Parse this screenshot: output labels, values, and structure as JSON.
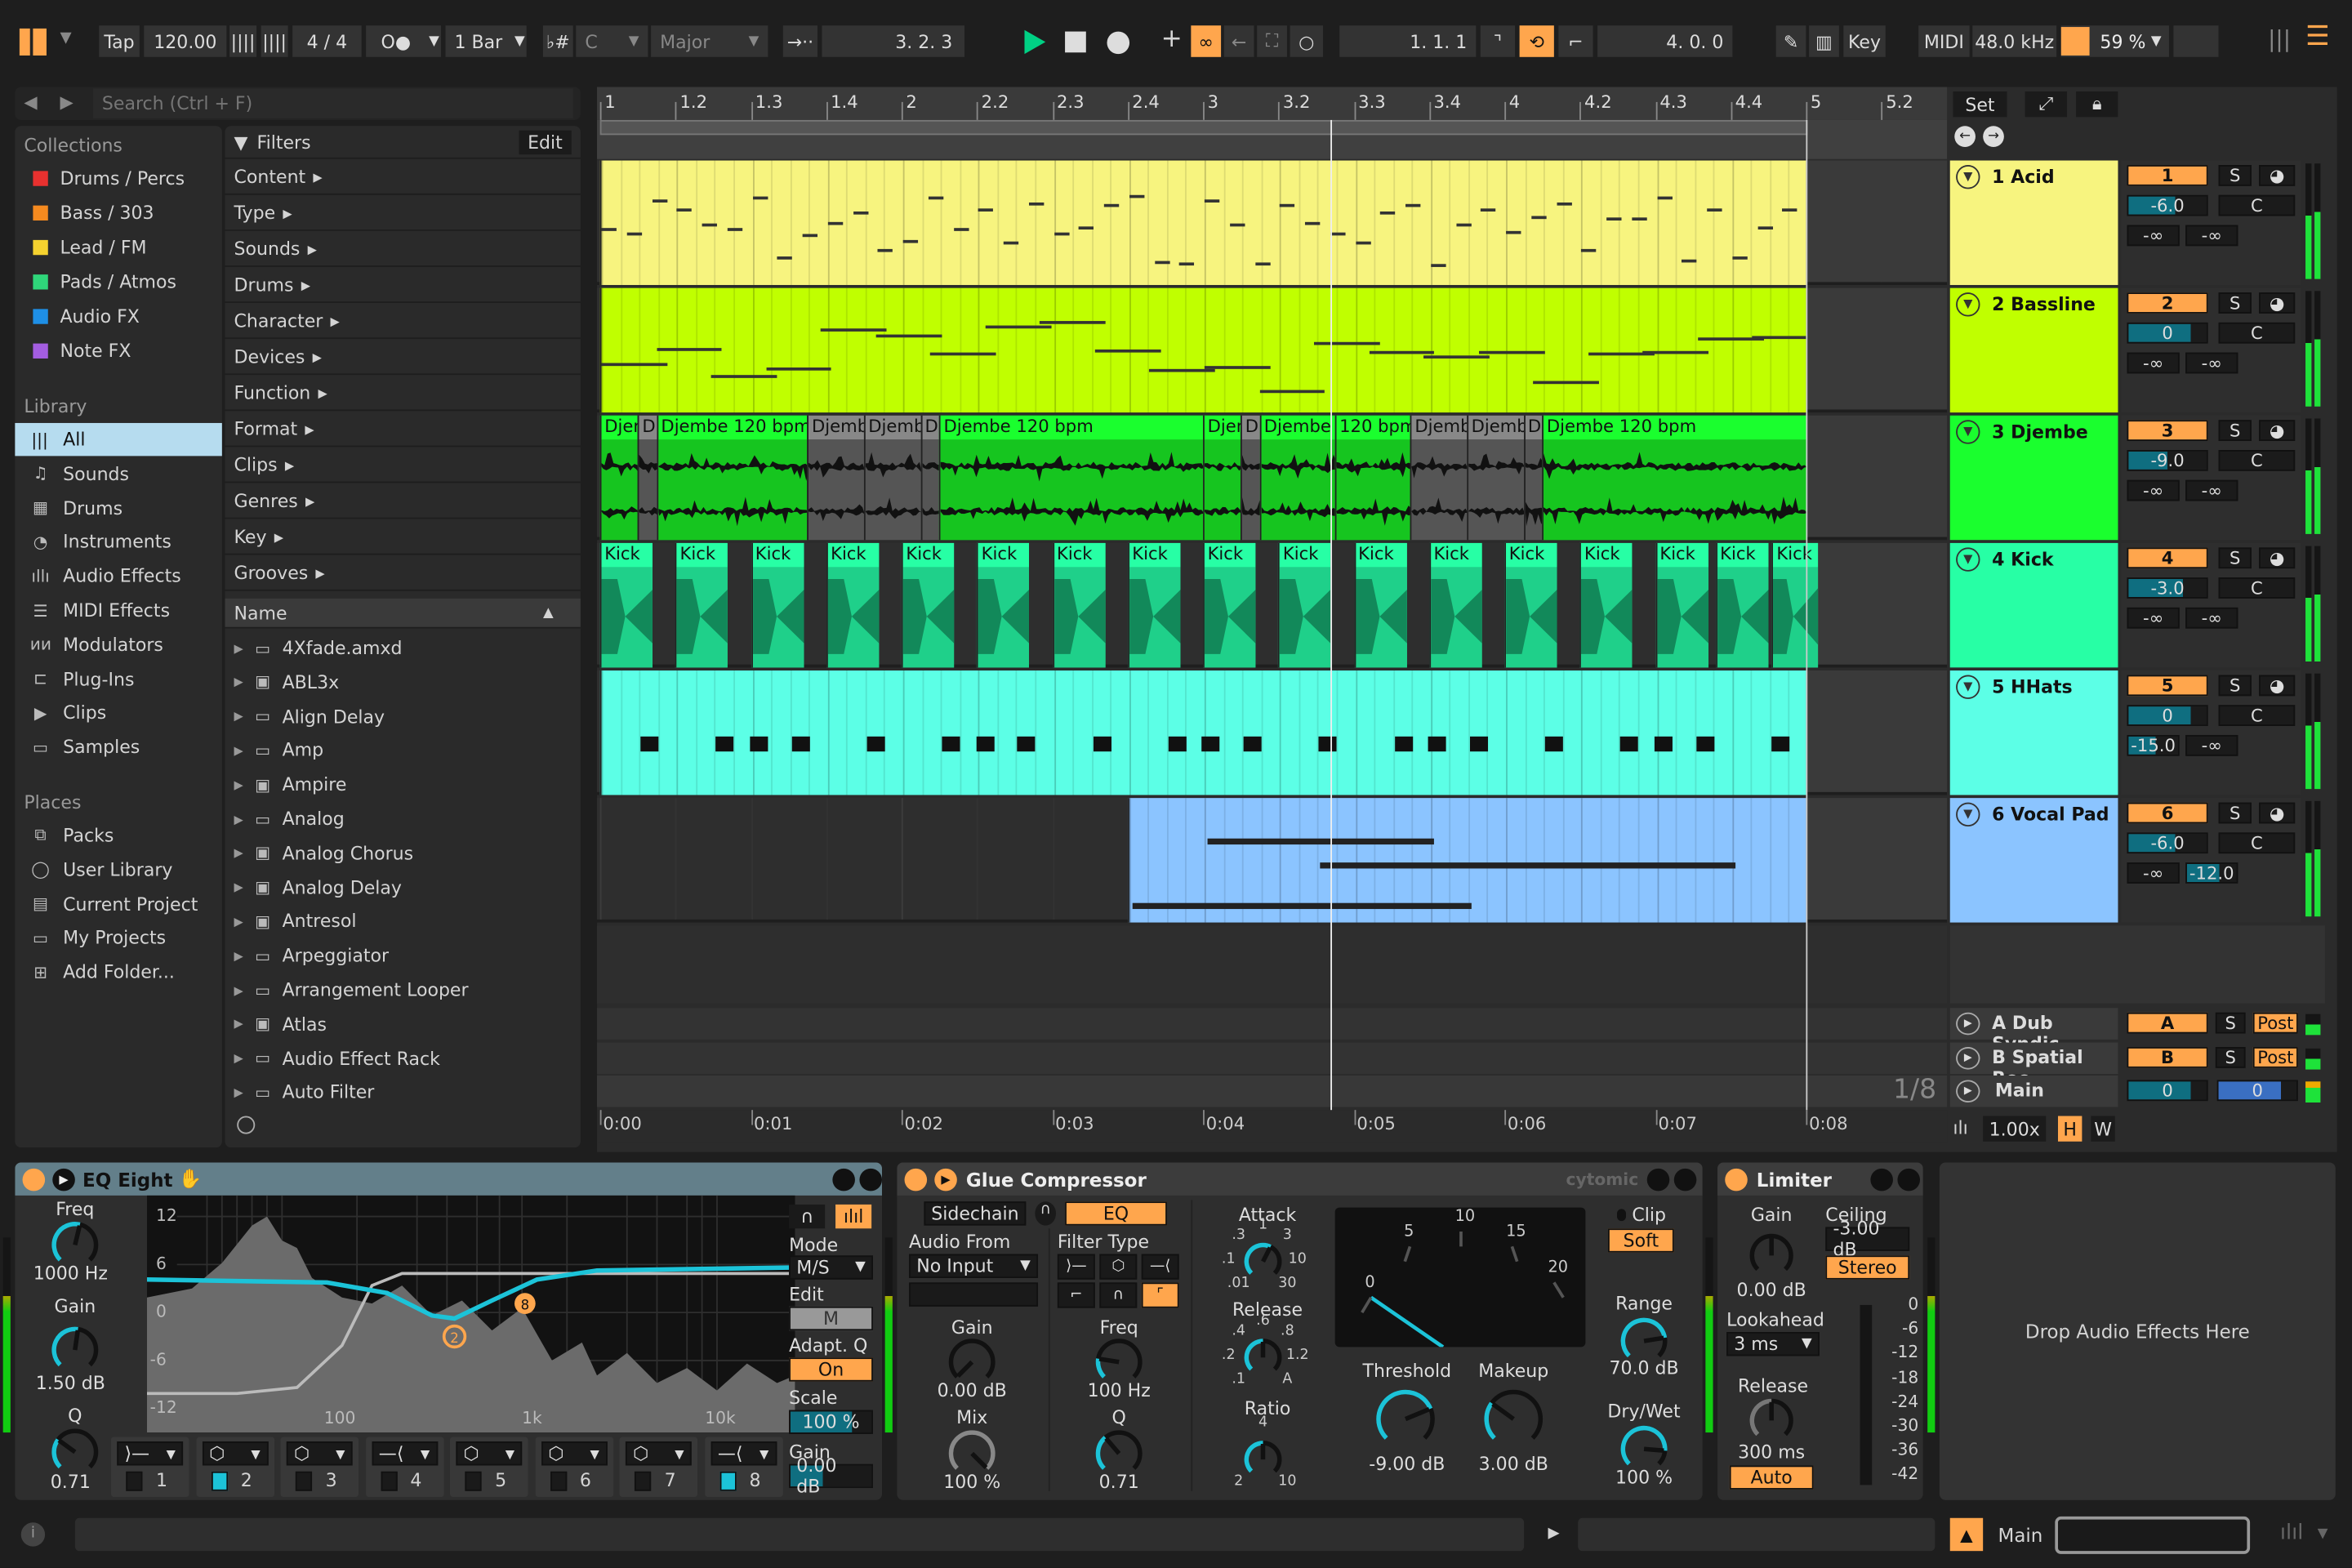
{
  "toolbar": {
    "tap": "Tap",
    "tempo": "120.00",
    "time_sig": "4 / 4",
    "metro": "O●",
    "quant": "1 Bar",
    "key_icon": "♭#",
    "key": "C",
    "scale": "Major",
    "position": "3.  2.  3",
    "loop_start": "1.  1.  1",
    "loop_length": "4.  0.  0",
    "key_label": "Key",
    "midi_label": "MIDI",
    "sample_rate": "48.0 kHz",
    "cpu": "59 %",
    "cpu_level": 59,
    "accent": "#ffa64d",
    "play_color": "#00d084"
  },
  "browser": {
    "search_placeholder": "Search (Ctrl + F)",
    "collections_title": "Collections",
    "collections": [
      {
        "label": "Drums / Percs",
        "color": "#e8312f"
      },
      {
        "label": "Bass / 303",
        "color": "#f58a1f"
      },
      {
        "label": "Lead / FM",
        "color": "#f5d22f"
      },
      {
        "label": "Pads / Atmos",
        "color": "#2fd67a"
      },
      {
        "label": "Audio FX",
        "color": "#1e8fe6"
      },
      {
        "label": "Note FX",
        "color": "#a35de0"
      }
    ],
    "library_title": "Library",
    "library": [
      {
        "label": "All",
        "icon": "bars-icon",
        "selected": true
      },
      {
        "label": "Sounds",
        "icon": "note-icon"
      },
      {
        "label": "Drums",
        "icon": "grid-icon"
      },
      {
        "label": "Instruments",
        "icon": "clock-icon"
      },
      {
        "label": "Audio Effects",
        "icon": "waveform-icon"
      },
      {
        "label": "MIDI Effects",
        "icon": "midi-icon"
      },
      {
        "label": "Modulators",
        "icon": "modulator-icon"
      },
      {
        "label": "Plug-Ins",
        "icon": "plug-icon"
      },
      {
        "label": "Clips",
        "icon": "play-icon"
      },
      {
        "label": "Samples",
        "icon": "sample-icon"
      }
    ],
    "places_title": "Places",
    "places": [
      {
        "label": "Packs",
        "icon": "packs-icon"
      },
      {
        "label": "User Library",
        "icon": "user-icon"
      },
      {
        "label": "Current Project",
        "icon": "project-icon"
      },
      {
        "label": "My Projects",
        "icon": "folder-icon"
      },
      {
        "label": "Add Folder...",
        "icon": "add-folder-icon"
      }
    ],
    "filters_title": "Filters",
    "edit_label": "Edit",
    "filters": [
      "Content",
      "Type",
      "Sounds",
      "Drums",
      "Character",
      "Devices",
      "Function",
      "Format",
      "Clips",
      "Genres",
      "Key",
      "Grooves"
    ],
    "name_header": "Name",
    "items": [
      {
        "label": "4Xfade.amxd",
        "icon": "device-icon"
      },
      {
        "label": "ABL3x",
        "icon": "plugin-icon"
      },
      {
        "label": "Align Delay",
        "icon": "device-icon"
      },
      {
        "label": "Amp",
        "icon": "device-icon"
      },
      {
        "label": "Ampire",
        "icon": "plugin-icon"
      },
      {
        "label": "Analog",
        "icon": "device-icon"
      },
      {
        "label": "Analog Chorus",
        "icon": "plugin-icon"
      },
      {
        "label": "Analog Delay",
        "icon": "plugin-icon"
      },
      {
        "label": "Antresol",
        "icon": "plugin-icon"
      },
      {
        "label": "Arpeggiator",
        "icon": "device-icon"
      },
      {
        "label": "Arrangement Looper",
        "icon": "device-icon"
      },
      {
        "label": "Atlas",
        "icon": "plugin-icon"
      },
      {
        "label": "Audio Effect Rack",
        "icon": "device-icon"
      },
      {
        "label": "Auto Filter",
        "icon": "device-icon"
      }
    ]
  },
  "arrangement": {
    "bar_ruler": [
      "1",
      "1.2",
      "1.3",
      "1.4",
      "2",
      "2.2",
      "2.3",
      "2.4",
      "3",
      "3.2",
      "3.3",
      "3.4",
      "4",
      "4.2",
      "4.3",
      "4.4",
      "5",
      "5.2"
    ],
    "time_ruler": [
      "0:00",
      "0:01",
      "0:02",
      "0:03",
      "0:04",
      "0:05",
      "0:06",
      "0:07",
      "0:08"
    ],
    "set_label": "Set",
    "grid_label": "1/8",
    "zoom": "1.00x",
    "h_label": "H",
    "w_label": "W",
    "playhead_beat": 9.7,
    "tracks": [
      {
        "name": "1 Acid",
        "color": "#f7f47f",
        "num": "1",
        "vol": "-6.0",
        "vol_level": 0.6,
        "pan": "C",
        "sendA": "-∞",
        "sendB": "-∞",
        "type": "midi",
        "clips": [
          {
            "start": 0,
            "end": 16,
            "label": ""
          }
        ]
      },
      {
        "name": "2 Bassline",
        "color": "#c0ff00",
        "num": "2",
        "vol": "0",
        "vol_level": 0.8,
        "pan": "C",
        "sendA": "-∞",
        "sendB": "-∞",
        "type": "midi",
        "clips": [
          {
            "start": 0,
            "end": 16,
            "label": ""
          }
        ]
      },
      {
        "name": "3 Djembe",
        "color": "#1aff2e",
        "num": "3",
        "vol": "-9.0",
        "vol_level": 0.5,
        "pan": "C",
        "sendA": "-∞",
        "sendB": "-∞",
        "type": "audio",
        "clips": [
          {
            "start": 0,
            "end": 0.5,
            "label": "Djer"
          },
          {
            "start": 0.5,
            "end": 0.75,
            "label": "D"
          },
          {
            "start": 0.75,
            "end": 2.75,
            "label": "Djembe 120 bpm"
          },
          {
            "start": 2.75,
            "end": 3.5,
            "label": "Djemb"
          },
          {
            "start": 3.5,
            "end": 4.25,
            "label": "Djemb"
          },
          {
            "start": 4.25,
            "end": 4.5,
            "label": "D"
          },
          {
            "start": 4.5,
            "end": 8,
            "label": "Djembe 120 bpm"
          },
          {
            "start": 8,
            "end": 8.5,
            "label": "Djer"
          },
          {
            "start": 8.5,
            "end": 8.75,
            "label": "D"
          },
          {
            "start": 8.75,
            "end": 9.75,
            "label": "Djembe"
          },
          {
            "start": 9.75,
            "end": 10.75,
            "label": "120 bpm"
          },
          {
            "start": 10.75,
            "end": 11.5,
            "label": "Djemb"
          },
          {
            "start": 11.5,
            "end": 12.25,
            "label": "Djemb"
          },
          {
            "start": 12.25,
            "end": 12.5,
            "label": "D"
          },
          {
            "start": 12.5,
            "end": 16,
            "label": "Djembe 120 bpm"
          }
        ]
      },
      {
        "name": "4 Kick",
        "color": "#27ffa5",
        "num": "4",
        "vol": "-3.0",
        "vol_level": 0.7,
        "pan": "C",
        "sendA": "-∞",
        "sendB": "-∞",
        "type": "kick",
        "clips": [
          {
            "start": 0,
            "end": 0.7,
            "label": "Kick"
          },
          {
            "start": 1,
            "end": 1.7,
            "label": "Kick"
          },
          {
            "start": 2,
            "end": 2.7,
            "label": "Kick"
          },
          {
            "start": 3,
            "end": 3.7,
            "label": "Kick"
          },
          {
            "start": 4,
            "end": 4.7,
            "label": "Kick"
          },
          {
            "start": 5,
            "end": 5.7,
            "label": "Kick"
          },
          {
            "start": 6,
            "end": 6.7,
            "label": "Kick"
          },
          {
            "start": 7,
            "end": 7.7,
            "label": "Kick"
          },
          {
            "start": 8,
            "end": 8.7,
            "label": "Kick"
          },
          {
            "start": 9,
            "end": 9.7,
            "label": "Kick"
          },
          {
            "start": 10,
            "end": 10.7,
            "label": "Kick"
          },
          {
            "start": 11,
            "end": 11.7,
            "label": "Kick"
          },
          {
            "start": 12,
            "end": 12.7,
            "label": "Kick"
          },
          {
            "start": 13,
            "end": 13.7,
            "label": "Kick"
          },
          {
            "start": 14,
            "end": 14.7,
            "label": "Kick"
          },
          {
            "start": 14.8,
            "end": 15.5,
            "label": "Kick"
          },
          {
            "start": 15.55,
            "end": 16.15,
            "label": "Kick"
          }
        ]
      },
      {
        "name": "5 HHats",
        "color": "#5cffe6",
        "num": "5",
        "vol": "0",
        "vol_level": 0.8,
        "pan": "C",
        "sendA": "-15.0",
        "sendA_level": 0.55,
        "sendB": "-∞",
        "type": "hats",
        "clips": [
          {
            "start": 0,
            "end": 16,
            "label": ""
          }
        ]
      },
      {
        "name": "6 Vocal Pad",
        "color": "#8bc4ff",
        "num": "6",
        "vol": "-6.0",
        "vol_level": 0.6,
        "pan": "C",
        "sendA": "-∞",
        "sendB": "-12.0",
        "sendB_level": 0.65,
        "type": "pad",
        "clips": [
          {
            "start": 7,
            "end": 16,
            "label": ""
          }
        ]
      }
    ],
    "returns": [
      {
        "name": "A Dub Syndic",
        "num": "A",
        "solo": "S",
        "post": "Post"
      },
      {
        "name": "B Spatial Roo",
        "num": "B",
        "solo": "S",
        "post": "Post"
      }
    ],
    "main": {
      "name": "Main",
      "vol": "0",
      "cue": "0"
    },
    "solo": "S"
  },
  "eq": {
    "title": "EQ Eight",
    "freq_label": "Freq",
    "freq": "1000 Hz",
    "gain_label": "Gain",
    "gain": "1.50 dB",
    "q_label": "Q",
    "q": "0.71",
    "y_ticks": [
      "12",
      "6",
      "0",
      "-6",
      "-12"
    ],
    "x_ticks": [
      "100",
      "1k",
      "10k"
    ],
    "mode_label": "Mode",
    "mode": "M/S",
    "edit_label": "Edit",
    "edit": "M",
    "adapt_label": "Adapt. Q",
    "adapt": "On",
    "scale_label": "Scale",
    "scale": "100 %",
    "scale_level": 0.75,
    "out_label": "Gain",
    "out": "0.00 dB",
    "bands": [
      "1",
      "2",
      "3",
      "4",
      "5",
      "6",
      "7",
      "8"
    ],
    "active_bands": [
      "2",
      "8"
    ],
    "curve_color": "#1cc3d8"
  },
  "glue": {
    "title": "Glue Compressor",
    "brand": "cytomic",
    "sidechain": "Sidechain",
    "eq": "EQ",
    "audio_from_label": "Audio From",
    "audio_from": "No Input",
    "filter_label": "Filter Type",
    "gain_label": "Gain",
    "gain": "0.00 dB",
    "mix_label": "Mix",
    "mix": "100 %",
    "freq_label": "Freq",
    "freq": "100 Hz",
    "q_label": "Q",
    "q": "0.71",
    "attack_label": "Attack",
    "attack_ticks": [
      ".01",
      ".1",
      ".3",
      "1",
      "3",
      "10",
      "30"
    ],
    "release_label": "Release",
    "release_ticks": [
      ".1",
      ".2",
      ".4",
      ".6",
      ".8",
      "1.2",
      "A"
    ],
    "ratio_label": "Ratio",
    "ratio_ticks": [
      "2",
      "4",
      "10"
    ],
    "meter_ticks": [
      "0",
      "5",
      "10",
      "15",
      "20"
    ],
    "threshold_label": "Threshold",
    "threshold": "-9.00 dB",
    "makeup_label": "Makeup",
    "makeup": "3.00 dB",
    "clip_label": "Clip",
    "clip": "Soft",
    "range_label": "Range",
    "range": "70.0 dB",
    "drywet_label": "Dry/Wet",
    "drywet": "100 %"
  },
  "limiter": {
    "title": "Limiter",
    "gain_label": "Gain",
    "gain": "0.00 dB",
    "ceiling_label": "Ceiling",
    "ceiling": "-3.00 dB",
    "stereo": "Stereo",
    "lookahead_label": "Lookahead",
    "lookahead": "3 ms",
    "release_label": "Release",
    "release": "300 ms",
    "auto": "Auto",
    "scale": [
      "0",
      "-6",
      "-12",
      "-18",
      "-24",
      "-30",
      "-36",
      "-42"
    ]
  },
  "drop_zone": "Drop Audio Effects Here",
  "status": {
    "track": "Main"
  }
}
